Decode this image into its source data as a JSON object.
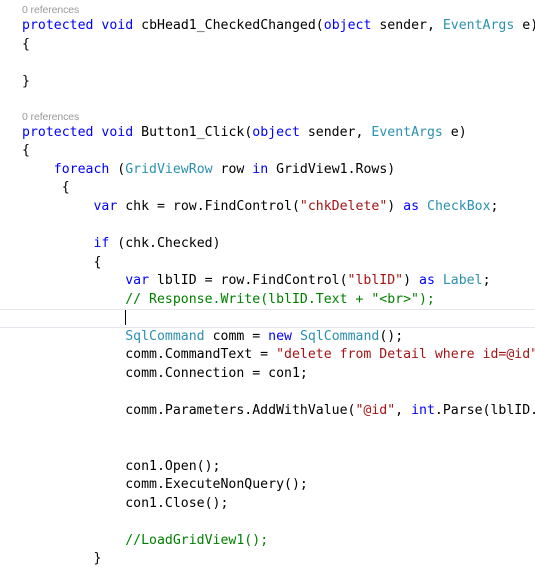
{
  "editor": {
    "app": "code-editor",
    "language": "csharp",
    "background": "#ffffff",
    "theme_colors": {
      "keyword": "#0000ff",
      "type": "#2b91af",
      "string": "#a31515",
      "comment": "#008000",
      "plain": "#000000",
      "codelens": "#9a9a9a",
      "current_line_border": "#e6e7ee"
    },
    "cursor": {
      "visible": true,
      "line_index": 15,
      "column_text": ""
    },
    "lines": [
      {
        "kind": "codelens",
        "text": "0 references"
      },
      {
        "kind": "code",
        "tokens": [
          {
            "t": "protected",
            "c": "kw"
          },
          {
            "t": " ",
            "c": "pln"
          },
          {
            "t": "void",
            "c": "kw"
          },
          {
            "t": " cbHead1_CheckedChanged(",
            "c": "pln"
          },
          {
            "t": "object",
            "c": "kw"
          },
          {
            "t": " sender, ",
            "c": "pln"
          },
          {
            "t": "EventArgs",
            "c": "type"
          },
          {
            "t": " e)",
            "c": "pln"
          }
        ]
      },
      {
        "kind": "code",
        "tokens": [
          {
            "t": "{",
            "c": "pln"
          }
        ]
      },
      {
        "kind": "code",
        "tokens": [
          {
            "t": "",
            "c": "pln"
          }
        ]
      },
      {
        "kind": "code",
        "tokens": [
          {
            "t": "}",
            "c": "pln"
          }
        ]
      },
      {
        "kind": "code",
        "tokens": [
          {
            "t": "",
            "c": "pln"
          }
        ]
      },
      {
        "kind": "codelens",
        "text": "0 references"
      },
      {
        "kind": "code",
        "tokens": [
          {
            "t": "protected",
            "c": "kw"
          },
          {
            "t": " ",
            "c": "pln"
          },
          {
            "t": "void",
            "c": "kw"
          },
          {
            "t": " Button1_Click(",
            "c": "pln"
          },
          {
            "t": "object",
            "c": "kw"
          },
          {
            "t": " sender, ",
            "c": "pln"
          },
          {
            "t": "EventArgs",
            "c": "type"
          },
          {
            "t": " e)",
            "c": "pln"
          }
        ]
      },
      {
        "kind": "code",
        "tokens": [
          {
            "t": "{",
            "c": "pln"
          }
        ]
      },
      {
        "kind": "code",
        "tokens": [
          {
            "t": "    ",
            "c": "pln"
          },
          {
            "t": "foreach",
            "c": "kw"
          },
          {
            "t": " (",
            "c": "pln"
          },
          {
            "t": "GridViewRow",
            "c": "type"
          },
          {
            "t": " row ",
            "c": "pln"
          },
          {
            "t": "in",
            "c": "kw"
          },
          {
            "t": " GridView1.Rows)",
            "c": "pln"
          }
        ]
      },
      {
        "kind": "code",
        "tokens": [
          {
            "t": "     {",
            "c": "pln"
          }
        ]
      },
      {
        "kind": "code",
        "tokens": [
          {
            "t": "         ",
            "c": "pln"
          },
          {
            "t": "var",
            "c": "kw"
          },
          {
            "t": " chk = row.FindControl(",
            "c": "pln"
          },
          {
            "t": "\"chkDelete\"",
            "c": "str"
          },
          {
            "t": ") ",
            "c": "pln"
          },
          {
            "t": "as",
            "c": "kw"
          },
          {
            "t": " ",
            "c": "pln"
          },
          {
            "t": "CheckBox",
            "c": "type"
          },
          {
            "t": ";",
            "c": "pln"
          }
        ]
      },
      {
        "kind": "code",
        "tokens": [
          {
            "t": "",
            "c": "pln"
          }
        ]
      },
      {
        "kind": "code",
        "tokens": [
          {
            "t": "         ",
            "c": "pln"
          },
          {
            "t": "if",
            "c": "kw"
          },
          {
            "t": " (chk.Checked)",
            "c": "pln"
          }
        ]
      },
      {
        "kind": "code",
        "tokens": [
          {
            "t": "         {",
            "c": "pln"
          }
        ]
      },
      {
        "kind": "code",
        "tokens": [
          {
            "t": "             ",
            "c": "pln"
          },
          {
            "t": "var",
            "c": "kw"
          },
          {
            "t": " lblID = row.FindControl(",
            "c": "pln"
          },
          {
            "t": "\"lblID\"",
            "c": "str"
          },
          {
            "t": ") ",
            "c": "pln"
          },
          {
            "t": "as",
            "c": "kw"
          },
          {
            "t": " ",
            "c": "pln"
          },
          {
            "t": "Label",
            "c": "type"
          },
          {
            "t": ";",
            "c": "pln"
          }
        ]
      },
      {
        "kind": "code",
        "tokens": [
          {
            "t": "             ",
            "c": "pln"
          },
          {
            "t": "// Response.Write(lblID.Text + \"<br>\");",
            "c": "cmt"
          }
        ]
      },
      {
        "kind": "code-current",
        "tokens": [
          {
            "t": "             ",
            "c": "pln"
          }
        ]
      },
      {
        "kind": "code",
        "tokens": [
          {
            "t": "             ",
            "c": "pln"
          },
          {
            "t": "SqlCommand",
            "c": "type"
          },
          {
            "t": " comm = ",
            "c": "pln"
          },
          {
            "t": "new",
            "c": "kw"
          },
          {
            "t": " ",
            "c": "pln"
          },
          {
            "t": "SqlCommand",
            "c": "type"
          },
          {
            "t": "();",
            "c": "pln"
          }
        ]
      },
      {
        "kind": "code",
        "tokens": [
          {
            "t": "             comm.CommandText = ",
            "c": "pln"
          },
          {
            "t": "\"delete from Detail where id=@id\"",
            "c": "str"
          },
          {
            "t": ";",
            "c": "pln"
          }
        ]
      },
      {
        "kind": "code",
        "tokens": [
          {
            "t": "             comm.Connection = con1;",
            "c": "pln"
          }
        ]
      },
      {
        "kind": "code",
        "tokens": [
          {
            "t": "",
            "c": "pln"
          }
        ]
      },
      {
        "kind": "code",
        "tokens": [
          {
            "t": "             comm.Parameters.AddWithValue(",
            "c": "pln"
          },
          {
            "t": "\"@id\"",
            "c": "str"
          },
          {
            "t": ", ",
            "c": "pln"
          },
          {
            "t": "int",
            "c": "kw"
          },
          {
            "t": ".Parse(lblID.Text));",
            "c": "pln"
          }
        ]
      },
      {
        "kind": "code",
        "tokens": [
          {
            "t": "",
            "c": "pln"
          }
        ]
      },
      {
        "kind": "code",
        "tokens": [
          {
            "t": "",
            "c": "pln"
          }
        ]
      },
      {
        "kind": "code",
        "tokens": [
          {
            "t": "             con1.Open();",
            "c": "pln"
          }
        ]
      },
      {
        "kind": "code",
        "tokens": [
          {
            "t": "             comm.ExecuteNonQuery();",
            "c": "pln"
          }
        ]
      },
      {
        "kind": "code",
        "tokens": [
          {
            "t": "             con1.Close();",
            "c": "pln"
          }
        ]
      },
      {
        "kind": "code",
        "tokens": [
          {
            "t": "",
            "c": "pln"
          }
        ]
      },
      {
        "kind": "code",
        "tokens": [
          {
            "t": "             ",
            "c": "pln"
          },
          {
            "t": "//LoadGridView1();",
            "c": "cmt"
          }
        ]
      },
      {
        "kind": "code",
        "tokens": [
          {
            "t": "         }",
            "c": "pln"
          }
        ]
      }
    ]
  }
}
